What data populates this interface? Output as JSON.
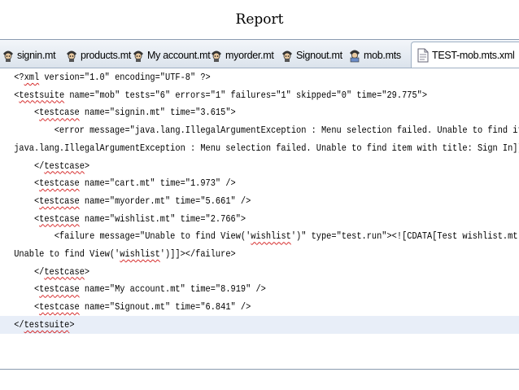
{
  "slide": {
    "title": "Report"
  },
  "tabs": [
    {
      "label": "signin.mt",
      "icon": "test-script-icon"
    },
    {
      "label": "products.mt",
      "icon": "test-script-icon"
    },
    {
      "label": "My account.mt",
      "icon": "test-script-icon"
    },
    {
      "label": "myorder.mt",
      "icon": "test-script-icon"
    },
    {
      "label": "Signout.mt",
      "icon": "test-script-icon"
    },
    {
      "label": "mob.mts",
      "icon": "test-suite-icon"
    },
    {
      "label": "TEST-mob.mts.xml",
      "icon": "xml-file-icon",
      "active": true,
      "close": "✕"
    }
  ],
  "code": {
    "lines": [
      [
        "<?",
        "xml",
        " version=\"1.0\" encoding=\"UTF-8\" ?>"
      ],
      [
        "<",
        "testsuite",
        " name=\"mob\" tests=\"6\" errors=\"1\" failures=\"1\" skipped=\"0\" time=\"29.775\">"
      ],
      [
        "    <",
        "testcase",
        " name=\"signin.mt\" time=\"3.615\">"
      ],
      [
        "        <error message=\"java.lang.IllegalArgumentException : Menu selection failed. Unable to find item"
      ],
      [
        "java.lang.IllegalArgumentException : Menu selection failed. Unable to find item with title: Sign In]]></"
      ],
      [
        "    </",
        "testcase",
        ">"
      ],
      [
        "    <",
        "testcase",
        " name=\"cart.mt\" time=\"1.973\" />"
      ],
      [
        "    <",
        "testcase",
        " name=\"myorder.mt\" time=\"5.661\" />"
      ],
      [
        "    <",
        "testcase",
        " name=\"wishlist.mt\" time=\"2.766\">"
      ],
      [
        "        <failure message=\"Unable to find View('",
        "wishlist",
        "')\" type=\"test.run\"><![CDATA[Test wishlist.mt Ru"
      ],
      [
        "Unable to find View('",
        "wishlist",
        "')]]></failure>"
      ],
      [
        "    </",
        "testcase",
        ">"
      ],
      [
        "    <",
        "testcase",
        " name=\"My account.mt\" time=\"8.919\" />"
      ],
      [
        "    <",
        "testcase",
        " name=\"Signout.mt\" time=\"6.841\" />"
      ],
      [
        "</",
        "testsuite",
        ">"
      ]
    ],
    "highlighted_line": 14
  }
}
